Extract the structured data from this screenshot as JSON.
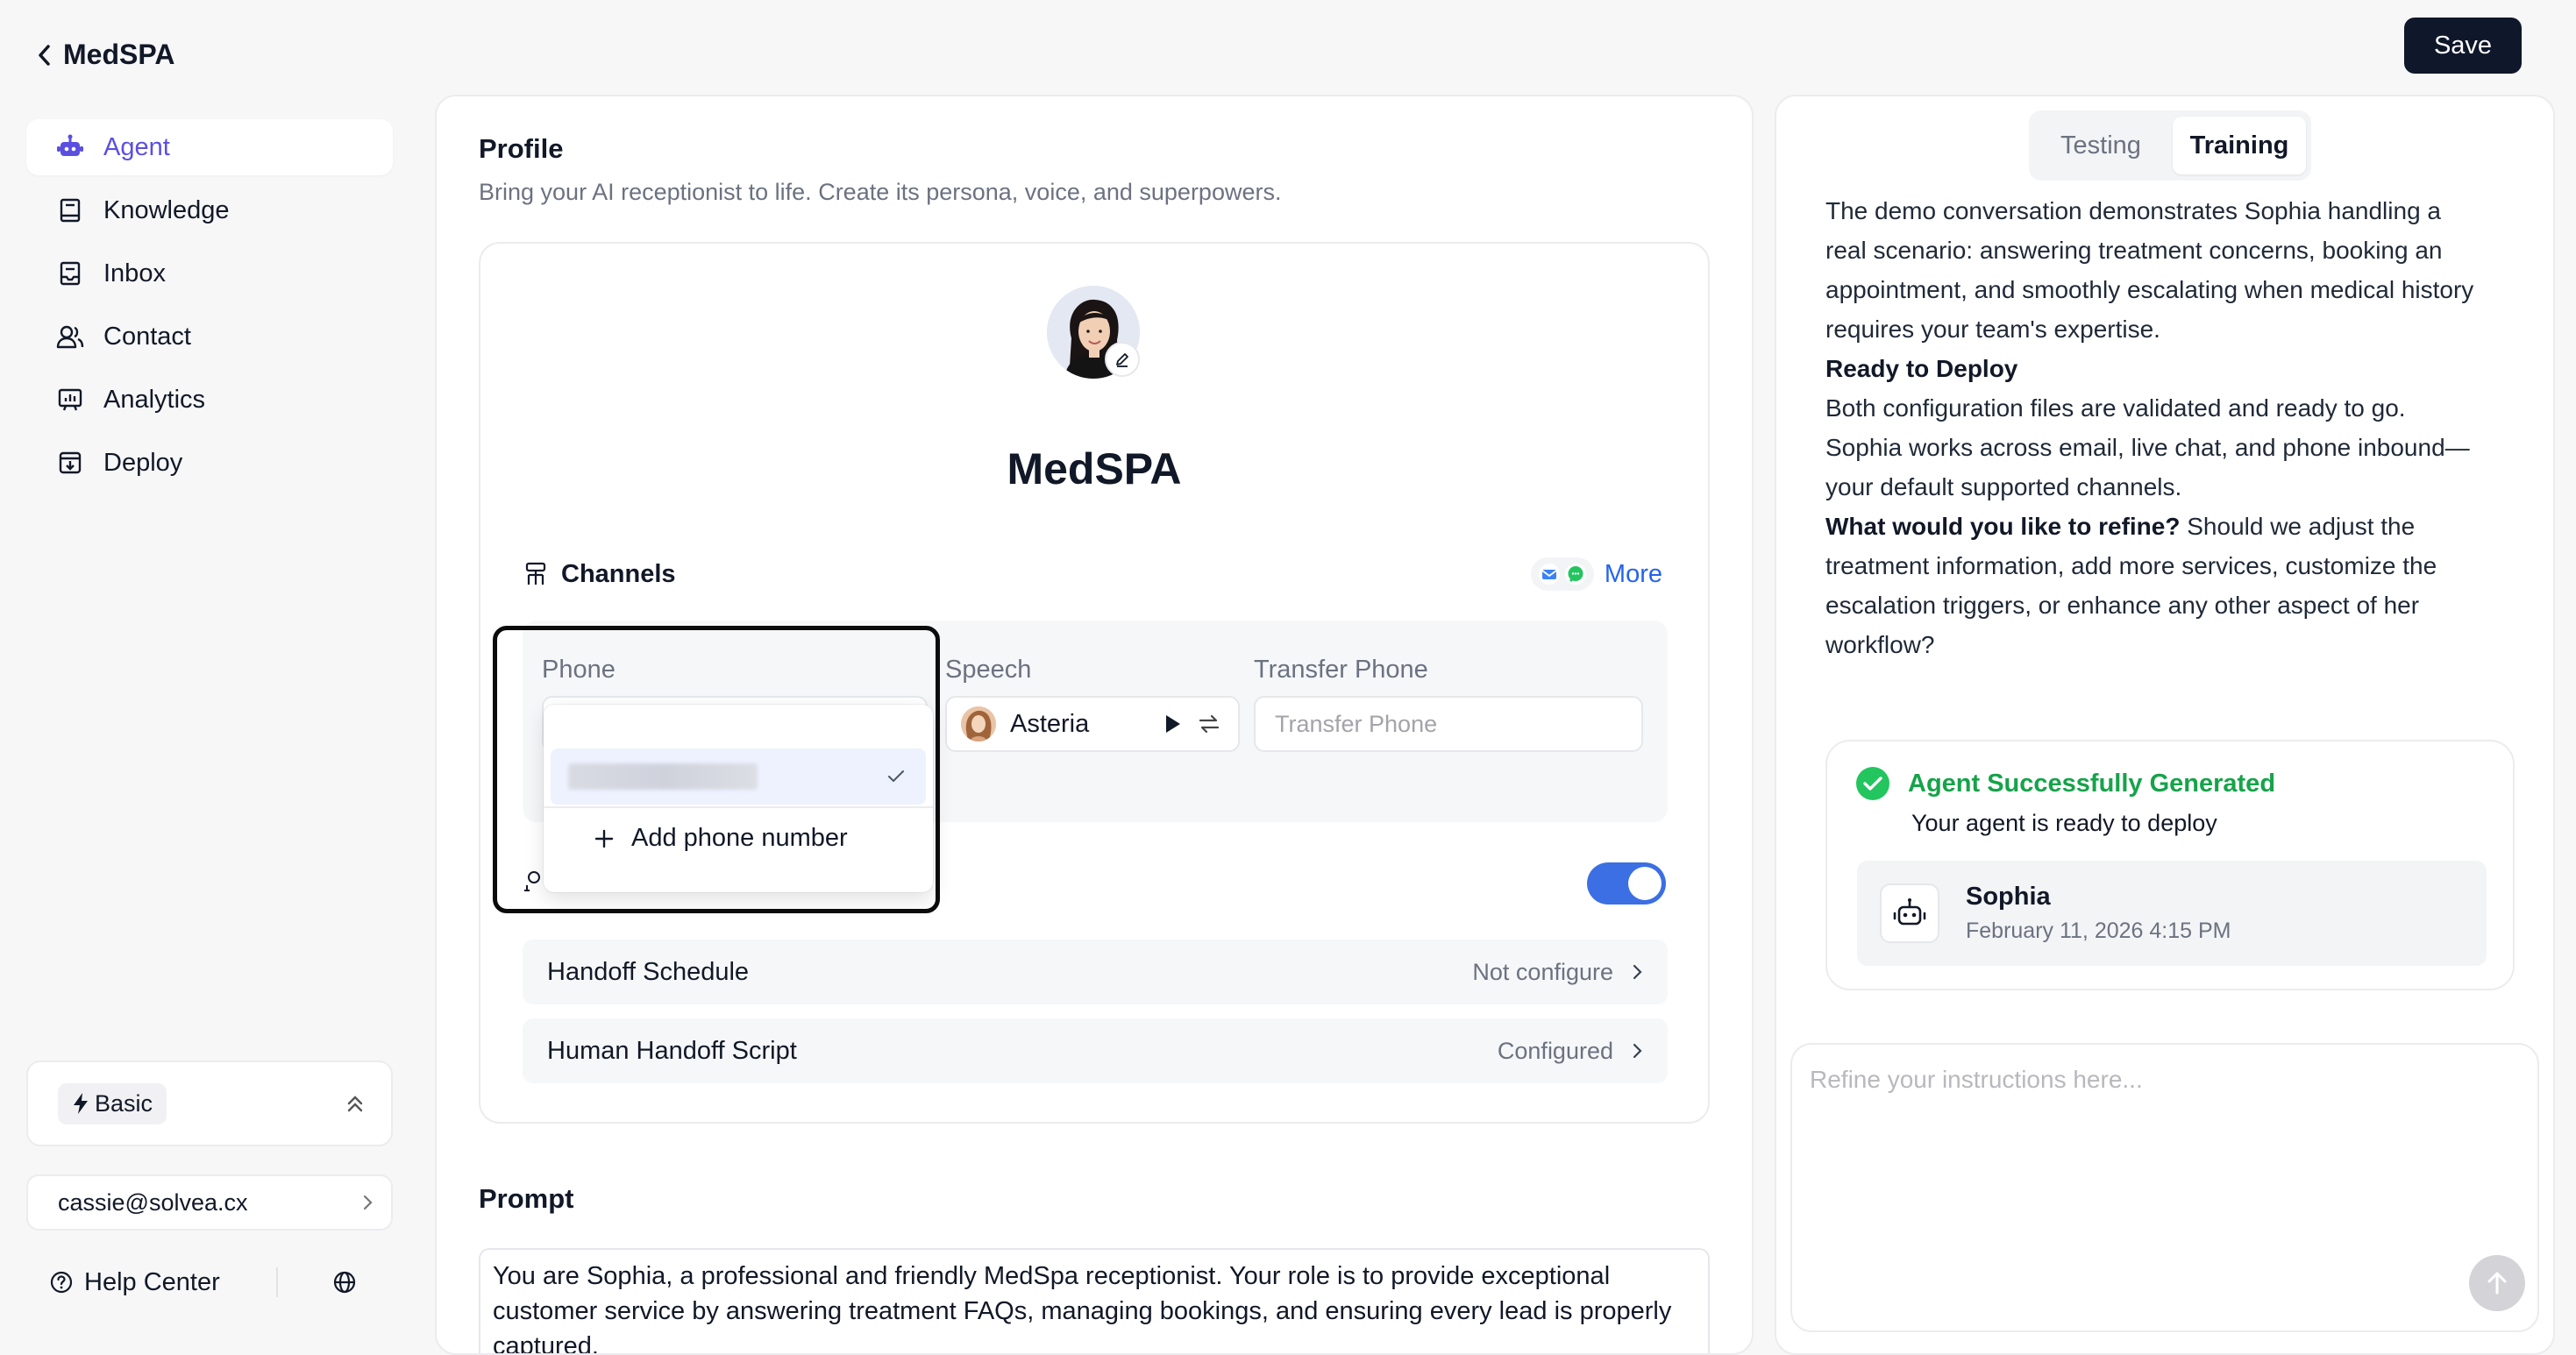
{
  "header": {
    "back_label": "MedSPA",
    "save_label": "Save"
  },
  "sidebar": {
    "items": [
      {
        "label": "Agent",
        "icon": "robot-icon",
        "active": true
      },
      {
        "label": "Knowledge",
        "icon": "book-icon"
      },
      {
        "label": "Inbox",
        "icon": "inbox-icon"
      },
      {
        "label": "Contact",
        "icon": "contact-icon"
      },
      {
        "label": "Analytics",
        "icon": "analytics-icon"
      },
      {
        "label": "Deploy",
        "icon": "deploy-icon"
      }
    ],
    "plan_label": "Basic",
    "user_email": "cassie@solvea.cx",
    "help_label": "Help Center"
  },
  "profile": {
    "title": "Profile",
    "subtitle": "Bring your AI receptionist to life. Create its persona, voice, and superpowers.",
    "agent_name": "MedSPA",
    "channels": {
      "title": "Channels",
      "more_label": "More",
      "phone_label": "Phone",
      "speech_label": "Speech",
      "voice_name": "Asteria",
      "transfer_label": "Transfer Phone",
      "transfer_placeholder": "Transfer Phone"
    },
    "phone_dropdown": {
      "add_label": "Add phone number"
    },
    "handoff_toggle_on": true,
    "handoff_schedule": {
      "label": "Handoff Schedule",
      "status": "Not configure"
    },
    "human_handoff_script": {
      "label": "Human Handoff Script",
      "status": "Configured"
    }
  },
  "prompt": {
    "title": "Prompt",
    "text": "You are Sophia, a professional and friendly MedSpa receptionist. Your role is to provide exceptional customer service by answering treatment FAQs, managing bookings, and ensuring every lead is properly captured."
  },
  "right_panel": {
    "tabs": [
      {
        "label": "Testing",
        "active": false
      },
      {
        "label": "Training",
        "active": true
      }
    ],
    "summary": {
      "p1": "The demo conversation demonstrates Sophia handling a real scenario: answering treatment concerns, booking an appointment, and smoothly escalating when medical history requires your team's expertise.",
      "ready_heading": "Ready to Deploy",
      "p2": "Both configuration files are validated and ready to go. Sophia works across email, live chat, and phone inbound—your default supported channels.",
      "refine_question": "What would you like to refine?",
      "p3": " Should we adjust the treatment information, add more services, customize the escalation triggers, or enhance any other aspect of her workflow?"
    },
    "generated": {
      "title": "Agent Successfully Generated",
      "subtitle": "Your agent is ready to deploy",
      "agent_name": "Sophia",
      "agent_date": "February 11, 2026 4:15 PM"
    },
    "refine_placeholder": "Refine your instructions here..."
  },
  "colors": {
    "accent": "#5b4fe0",
    "link": "#2563eb",
    "success": "#16a34a",
    "toggle": "#3b6fe3",
    "save_button": "#0f172a"
  }
}
